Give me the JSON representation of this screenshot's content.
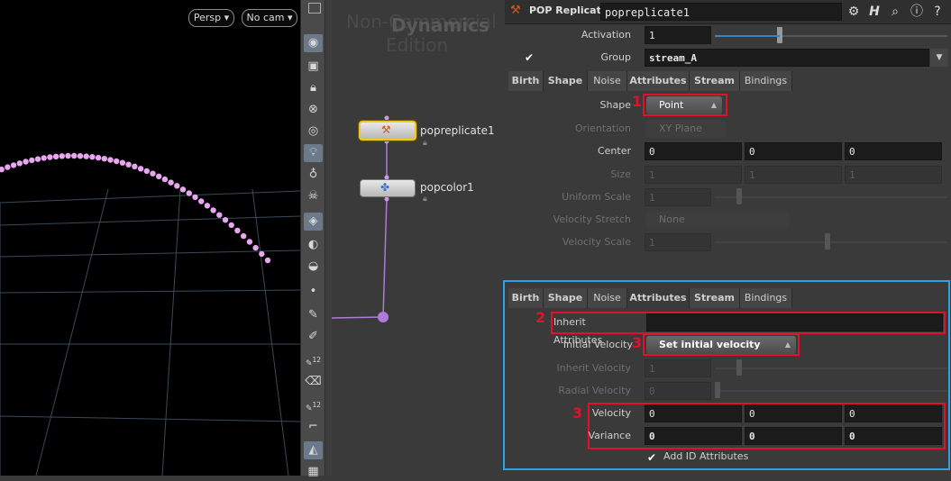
{
  "viewport": {
    "persp_label": "Persp",
    "cam_label": "No cam"
  },
  "toolbar": {
    "num_a": "12",
    "num_b": "12"
  },
  "network": {
    "watermark_line1": "Non-Commercial",
    "watermark_line2": "Edition",
    "watermark_overlay": "Dynamics",
    "nodes": [
      {
        "label": "popreplicate1"
      },
      {
        "label": "popcolor1"
      }
    ]
  },
  "params": {
    "node_type": "POP Replicate",
    "node_name": "popreplicate1",
    "activation_label": "Activation",
    "activation_value": "1",
    "activation_fraction": 0.28,
    "group_label": "Group",
    "group_value": "stream_A",
    "tabs": [
      "Birth",
      "Shape",
      "Noise",
      "Attributes",
      "Stream",
      "Bindings"
    ],
    "shape_section": {
      "shape_label": "Shape",
      "shape_value": "Point",
      "orientation_label": "Orientation",
      "orientation_value": "XY Plane",
      "center_label": "Center",
      "center_values": [
        "0",
        "0",
        "0"
      ],
      "size_label": "Size",
      "size_values": [
        "1",
        "1",
        "1"
      ],
      "uniform_scale_label": "Uniform Scale",
      "uniform_scale_value": "1",
      "velocity_stretch_label": "Velocity Stretch",
      "velocity_stretch_value": "None",
      "velocity_scale_label": "Velocity Scale",
      "velocity_scale_value": "1"
    },
    "attributes_section": {
      "inherit_attributes_label": "Inherit Attributes",
      "inherit_attributes_value": "",
      "initial_velocity_label": "Initial Velocity",
      "initial_velocity_value": "Set initial velocity",
      "inherit_velocity_label": "Inherit Velocity",
      "inherit_velocity_value": "1",
      "radial_velocity_label": "Radial Velocity",
      "radial_velocity_value": "0",
      "velocity_label": "Velocity",
      "velocity_values": [
        "0",
        "0",
        "0"
      ],
      "variance_label": "Variance",
      "variance_values": [
        "0",
        "0",
        "0"
      ],
      "add_id_label": "Add ID Attributes"
    }
  },
  "annotations": {
    "n1": "1",
    "n2": "2",
    "n3a": "3",
    "n3b": "3"
  },
  "colors": {
    "annotation_red": "#e3102a",
    "annotation_blue": "#2aa3e8",
    "particle_pink": "#e9a6f0",
    "selected_node": "#f5c518",
    "wire": "#b07ad8"
  }
}
